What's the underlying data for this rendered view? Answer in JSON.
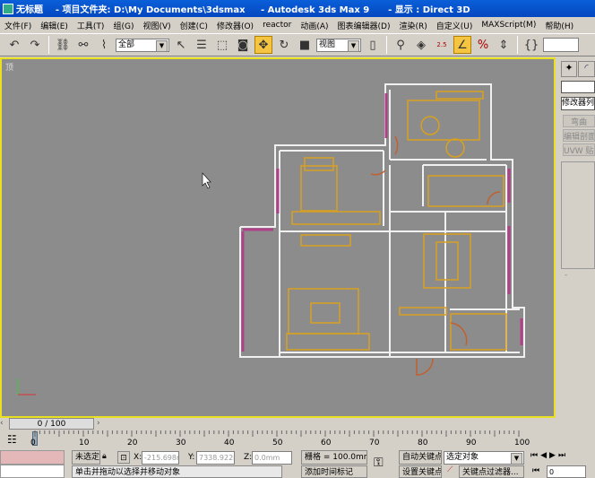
{
  "window": {
    "title": "无标题    - 项目文件夹: D:\\My Documents\\3dsmax     - Autodesk 3ds Max 9      - 显示 : Direct 3D"
  },
  "menu": [
    "文件(F)",
    "编辑(E)",
    "工具(T)",
    "组(G)",
    "视图(V)",
    "创建(C)",
    "修改器(O)",
    "reactor",
    "动画(A)",
    "图表编辑器(D)",
    "渲染(R)",
    "自定义(U)",
    "MAXScript(M)",
    "帮助(H)"
  ],
  "toolbar": {
    "selection_filter": "全部",
    "coord_system": "视图",
    "snap_value": "2.5",
    "percent_snap": "%"
  },
  "viewport": {
    "label": "顶",
    "active_border": "#e8e020",
    "bg": "#8c8c8c"
  },
  "panel": {
    "modifier_list": "修改器列表",
    "buttons": [
      "弯曲",
      "编辑剖面",
      "UVW 贴图"
    ],
    "bottom": "-"
  },
  "timeline": {
    "frame": "0 / 100",
    "ticks": [
      "0",
      "10",
      "20",
      "30",
      "40",
      "50",
      "60",
      "70",
      "80",
      "90",
      "100"
    ]
  },
  "status": {
    "selection": "未选定",
    "x_label": "X:",
    "x_value": "-215.698m",
    "y_label": "Y:",
    "y_value": "7338.922m",
    "z_label": "Z:",
    "z_value": "0.0mm",
    "grid": "栅格 = 100.0mm",
    "prompt": "单击并拖动以选择并移动对象",
    "add_time_tag": "添加时间标记",
    "auto_key": "自动关键点",
    "set_key": "设置关键点",
    "key_mode": "选定对象",
    "key_filters": "关键点过滤器...",
    "current_frame": "0"
  }
}
